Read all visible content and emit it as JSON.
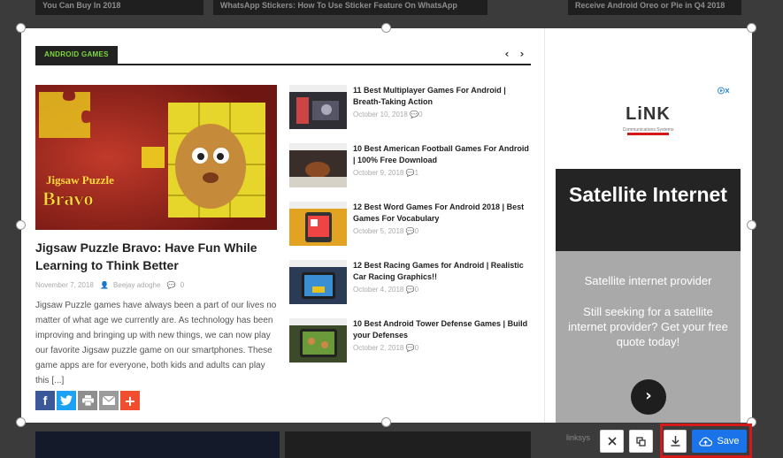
{
  "top_cards": [
    "You Can Buy In 2018",
    "WhatsApp Stickers: How To Use Sticker Feature On WhatsApp",
    "Receive Android Oreo or Pie in Q4 2018"
  ],
  "section": {
    "title": "ANDROID GAMES",
    "prev_icon": "‹",
    "next_icon": "›"
  },
  "featured": {
    "image_text_line1": "Jigsaw Puzzle",
    "image_text_line2": "Bravo",
    "title": "Jigsaw Puzzle Bravo: Have Fun While Learning to Think Better",
    "date": "November 7, 2018",
    "author": "Beejay adoghe",
    "comments": "0",
    "excerpt": "Jigsaw Puzzle games have always been a part of our lives no matter of what age we currently are. As technology has been improving and bringing up with new things, we can now play our favorite Jigsaw puzzle game on our smartphones. These game apps are for everyone, both kids and adults can play this [...]"
  },
  "share": [
    {
      "icon": "facebook-icon",
      "color": "#3b5998",
      "glyph": "f"
    },
    {
      "icon": "twitter-icon",
      "color": "#1da1f2",
      "glyph": "t"
    },
    {
      "icon": "print-icon",
      "color": "#8e8e8e",
      "glyph": "⎙"
    },
    {
      "icon": "email-icon",
      "color": "#9a9a9a",
      "glyph": "✉"
    },
    {
      "icon": "more-icon",
      "color": "#f14e30",
      "glyph": "+"
    }
  ],
  "articles": [
    {
      "title": "11 Best Multiplayer Games For Android | Breath-Taking Action",
      "date": "October 10, 2018",
      "comments": "0"
    },
    {
      "title": "10 Best American Football Games For Android | 100% Free Download",
      "date": "October 9, 2018",
      "comments": "1"
    },
    {
      "title": "12 Best Word Games For Android 2018 | Best Games For Vocabulary",
      "date": "October 5, 2018",
      "comments": "0"
    },
    {
      "title": "12 Best Racing Games for Android | Realistic Car Racing Graphics!!",
      "date": "October 4, 2018",
      "comments": "0"
    },
    {
      "title": "10 Best Android Tower Defense Games | Build your Defenses",
      "date": "October 2, 2018",
      "comments": "0"
    }
  ],
  "ad": {
    "logo": "LiNK",
    "logo_sub": "Communications Systems",
    "headline": "Satellite Internet",
    "sub": "Satellite internet provider",
    "body": "Still seeking for a satellite internet provider? Get your free quote today!",
    "arrow": "›",
    "footer": "linksys"
  },
  "toolbar": {
    "save_label": "Save"
  },
  "colors": {
    "accent_green": "#7dd83b",
    "save_blue": "#1a73e8",
    "highlight_red": "#d4191b"
  }
}
